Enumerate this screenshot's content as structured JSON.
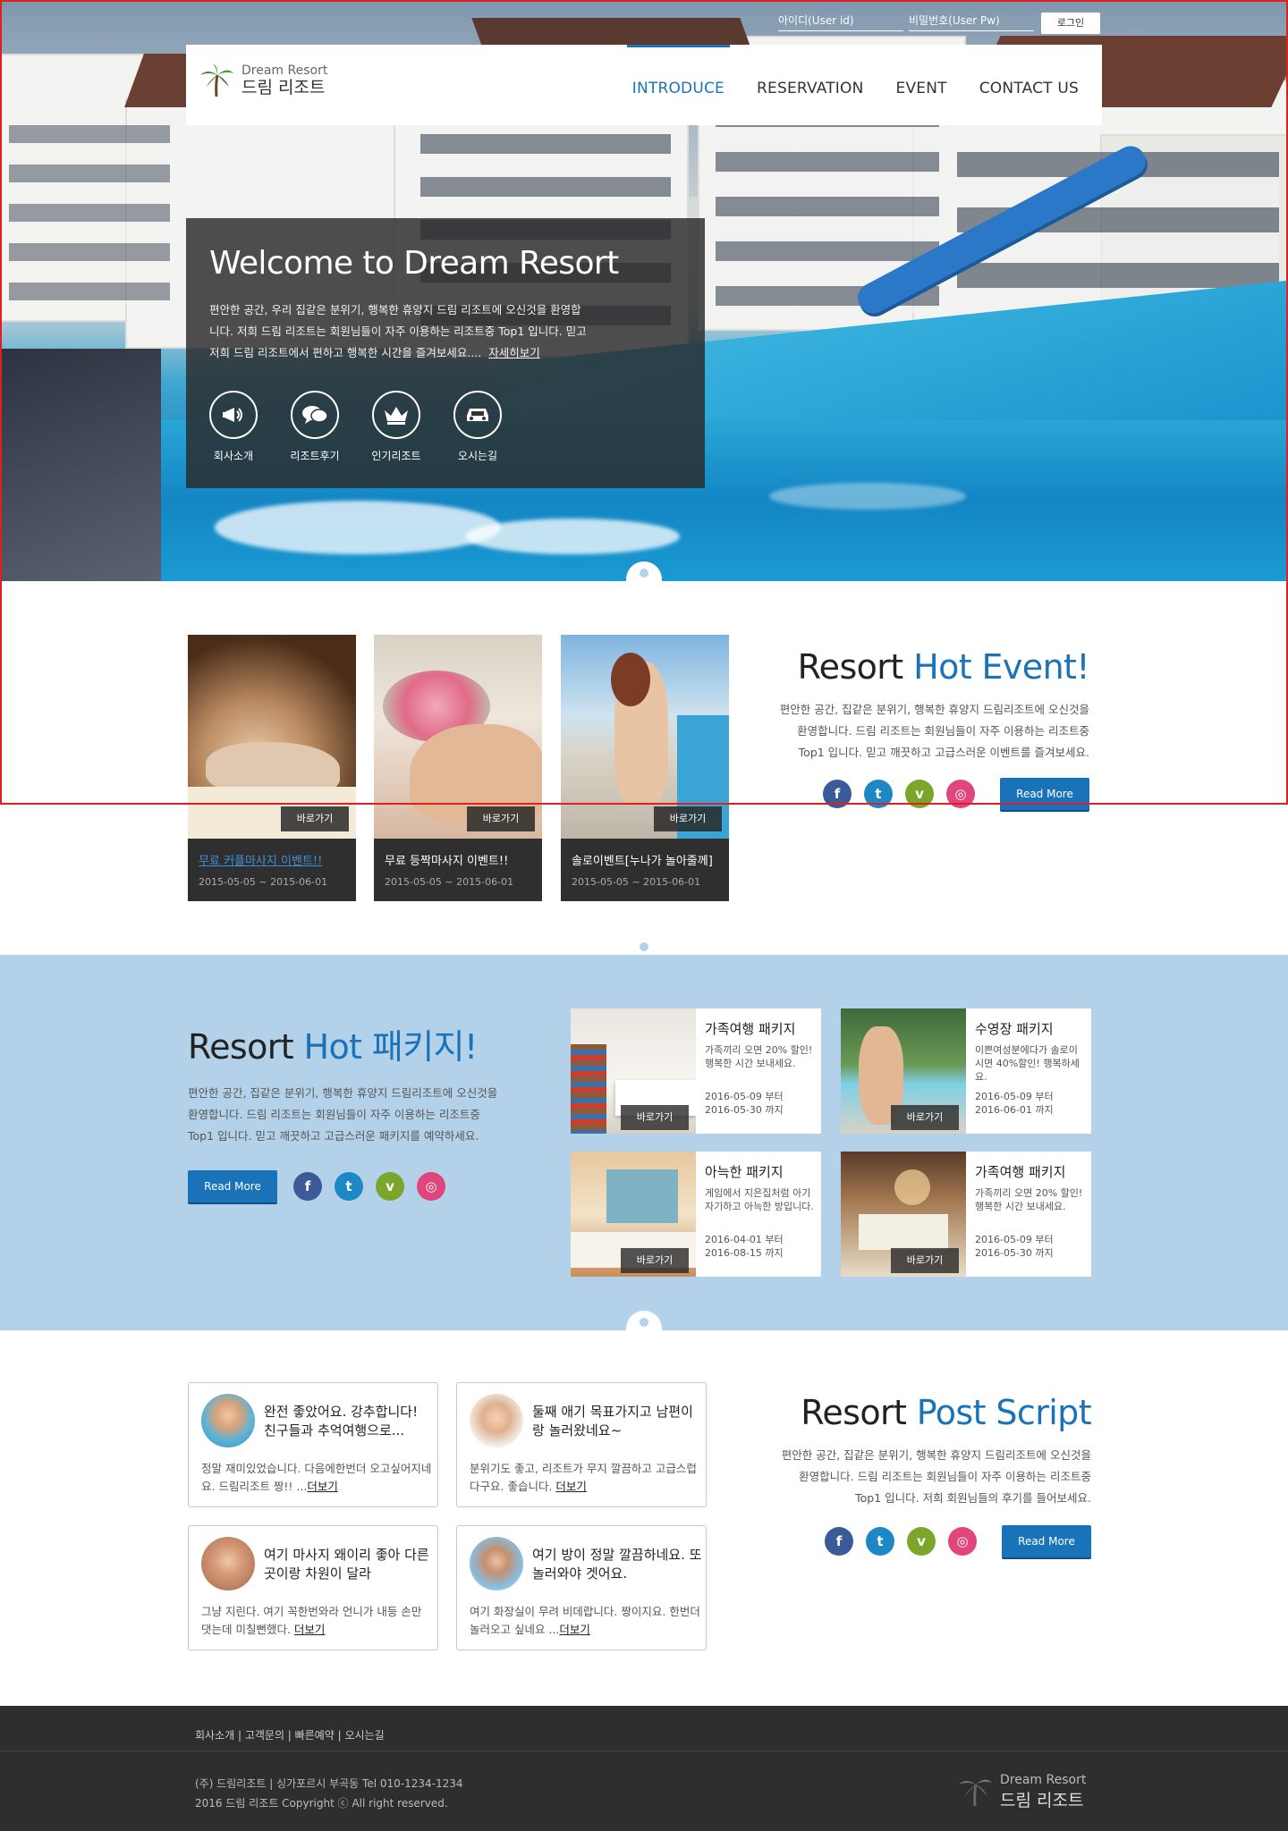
{
  "header": {
    "user_id_placeholder": "아이디(User id)",
    "user_pw_placeholder": "비밀번호(User Pw)",
    "login_label": "로그인",
    "logo_en": "Dream Resort",
    "logo_ko": "드림 리조트",
    "menu": [
      "INTRODUCE",
      "RESERVATION",
      "EVENT",
      "CONTACT US"
    ]
  },
  "hero": {
    "title": "Welcome to Dream Resort",
    "line1": "편안한 공간, 우리 집같은 분위기, 행복한 휴양지 드림 리조트에 오신것을 환영합",
    "line2": "니다. 저희 드림 리조트는 회원님들이 자주 이용하는 리조트중 Top1 입니다. 믿고",
    "line3": "저희 드림 리조트에서 편하고 행복한 시간을 즐겨보세요....",
    "more": "자세히보기",
    "quick": [
      "회사소개",
      "리조트후기",
      "인기리조트",
      "오시는길"
    ]
  },
  "event": {
    "title_plain": "Resort ",
    "title_hl": "Hot Event!",
    "desc1": "편안한 공간, 집같은 분위기, 행복한 휴양지 드림리조트에 오신것을",
    "desc2": "환영합니다. 드림 리조트는 회원님들이 자주 이용하는 리조트중",
    "desc3": "Top1 입니다. 믿고 깨끗하고 고급스러운 이벤트를 즐겨보세요.",
    "read_more": "Read More",
    "go_label": "바로가기",
    "cards": [
      {
        "title": "무료 커플마사지 이벤트!!",
        "date": "2015-05-05 ~ 2015-06-01"
      },
      {
        "title": "무료 등짝마사지 이벤트!!",
        "date": "2015-05-05 ~ 2015-06-01"
      },
      {
        "title": "솔로이벤트[누나가 놀아줄께]",
        "date": "2015-05-05 ~ 2015-06-01"
      }
    ]
  },
  "package": {
    "title_plain": "Resort ",
    "title_hl": "Hot 패키지!",
    "desc1": "편안한 공간, 집같은 분위기, 행복한 휴양지 드림리조트에 오신것을",
    "desc2": "환영합니다. 드림 리조트는 회원님들이 자주 이용하는 리조트중",
    "desc3": "Top1 입니다. 믿고 깨끗하고 고급스러운 패키지를 예약하세요.",
    "read_more": "Read More",
    "go_label": "바로가기",
    "items": [
      {
        "name": "가족여행 패키지",
        "desc": "가족끼리 오면 20% 할인! 행복한 시간 보내세요.",
        "d1": "2016-05-09 부터",
        "d2": "2016-05-30 까지"
      },
      {
        "name": "수영장 패키지",
        "desc": "이쁜여성분에다가 솔로이시면 40%할인! 행복하세요.",
        "d1": "2016-05-09 부터",
        "d2": "2016-06-01 까지"
      },
      {
        "name": "아늑한 패키지",
        "desc": "게임에서 지은집처럼 아기자기하고 아늑한 방입니다.",
        "d1": "2016-04-01 부터",
        "d2": "2016-08-15 까지"
      },
      {
        "name": "가족여행 패키지",
        "desc": "가족끼리 오면 20% 할인! 행복한 시간 보내세요.",
        "d1": "2016-05-09 부터",
        "d2": "2016-05-30 까지"
      }
    ]
  },
  "review": {
    "title_plain": "Resort ",
    "title_hl": "Post Script",
    "desc1": "편안한 공간, 집같은 분위기, 행복한 휴양지 드림리조트에 오신것을",
    "desc2": "환영합니다. 드림 리조트는 회원님들이 자주 이용하는 리조트중",
    "desc3": "Top1 입니다. 저희 회원님들의 후기를 들어보세요.",
    "read_more": "Read More",
    "more_label": "더보기",
    "items": [
      {
        "title": "완전 좋았어요. 강추합니다! 친구들과 추억여행으로...",
        "body": "정말 재미있었습니다. 다음에한번더 오고싶어지네요. 드림리조트 짱!! ..."
      },
      {
        "title": "둘째 애기 목표가지고 남편이랑 놀러왔네요~",
        "body": "분위기도 좋고, 리조트가 무지 깔끔하고 고급스럽다구요. 좋습니다. "
      },
      {
        "title": "여기 마사지 왜이리 좋아 다른곳이랑 차원이 달라",
        "body": "그냥 지린다. 여기 꼭한번와라 언니가 내등 손만 댓는데 미칠뻔했다. "
      },
      {
        "title": "여기 방이 정말 깔끔하네요. 또 놀러와야 겟어요.",
        "body": "여기 화장실이 무려 비데랍니다. 짱이지요. 한번더 놀러오고 싶네요 ..."
      }
    ]
  },
  "footer": {
    "links": "회사소개  |  고객문의  |  빠른예약  |  오시는길",
    "address": "(주) 드림리조트 | 싱가포르시 부곡동 Tel 010-1234-1234",
    "copyright": "2016 드림 리조트 Copyright ⓒ All right reserved.",
    "logo_en": "Dream Resort",
    "logo_ko": "드림 리조트"
  },
  "colors": {
    "accent": "#1a73b8",
    "package_bg": "#b3d2ea",
    "footer_bg": "#2e2e2e"
  },
  "icons": [
    "megaphone-icon",
    "chat-icon",
    "crown-icon",
    "car-icon",
    "facebook-icon",
    "twitter-icon",
    "vimeo-icon",
    "dribbble-icon",
    "palm-logo-icon"
  ]
}
